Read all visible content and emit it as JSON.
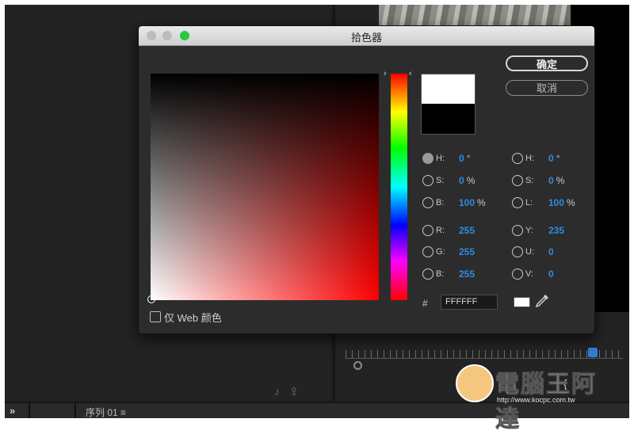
{
  "dialog": {
    "title": "拾色器",
    "ok_label": "确定",
    "cancel_label": "取消",
    "hex_label": "#",
    "hex_value": "FFFFFF",
    "web_colors_label": "仅 Web 颜色",
    "new_color": "#ffffff",
    "old_color": "#000000"
  },
  "fields_left": [
    {
      "label": "H:",
      "value": "0",
      "unit": "°",
      "selected": true
    },
    {
      "label": "S:",
      "value": "0",
      "unit": "%",
      "selected": false
    },
    {
      "label": "B:",
      "value": "100",
      "unit": "%",
      "selected": false
    },
    {
      "label": "R:",
      "value": "255",
      "unit": "",
      "selected": false
    },
    {
      "label": "G:",
      "value": "255",
      "unit": "",
      "selected": false
    },
    {
      "label": "B:",
      "value": "255",
      "unit": "",
      "selected": false
    }
  ],
  "fields_right": [
    {
      "label": "H:",
      "value": "0",
      "unit": "°",
      "selected": false
    },
    {
      "label": "S:",
      "value": "0",
      "unit": "%",
      "selected": false
    },
    {
      "label": "L:",
      "value": "100",
      "unit": "%",
      "selected": false
    },
    {
      "label": "Y:",
      "value": "235",
      "unit": "",
      "selected": false
    },
    {
      "label": "U:",
      "value": "0",
      "unit": "",
      "selected": false
    },
    {
      "label": "V:",
      "value": "0",
      "unit": "",
      "selected": false
    }
  ],
  "background": {
    "sequence_tab": "序列 01 ≡"
  },
  "watermark": {
    "text": "電腦王阿達",
    "url": "http://www.kocpc.com.tw"
  },
  "colors": {
    "accent_blue": "#2f8ce0",
    "close_button": "#bcbcbc",
    "minimize_button": "#bcbcbc",
    "zoom_button": "#27c93f"
  }
}
